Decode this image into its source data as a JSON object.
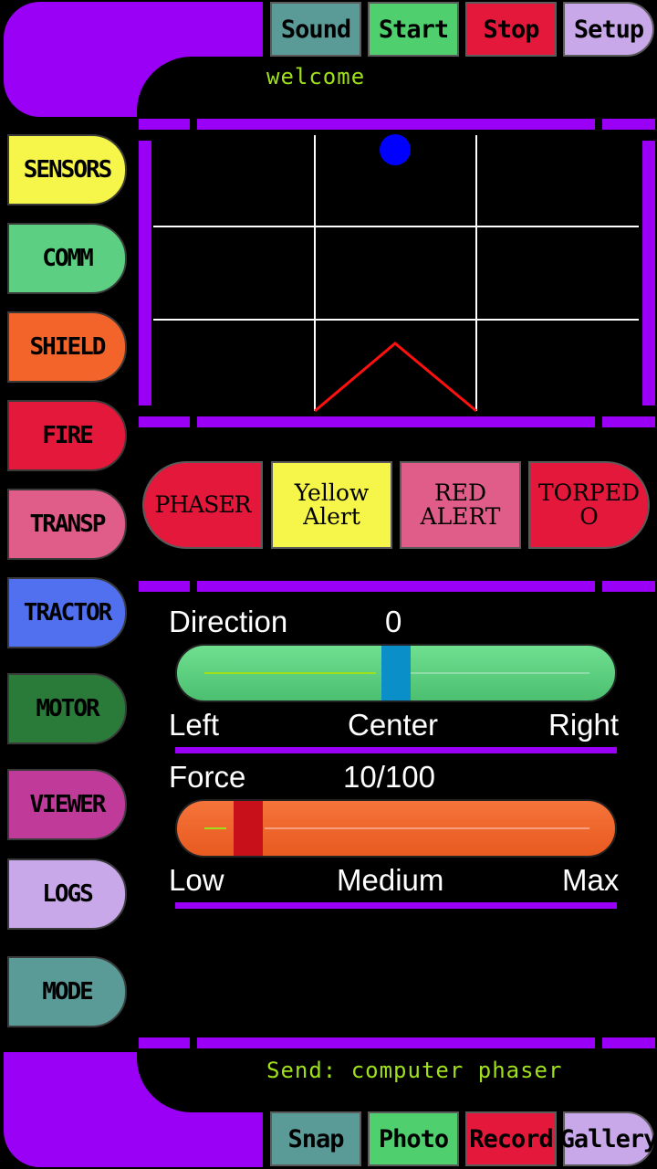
{
  "header": {
    "welcome": "welcome"
  },
  "top_buttons": [
    {
      "label": "Sound",
      "color": "#5a9a97"
    },
    {
      "label": "Start",
      "color": "#4fcf6e"
    },
    {
      "label": "Stop",
      "color": "#e3183a"
    },
    {
      "label": "Setup",
      "color": "#c8a8e8"
    }
  ],
  "sidebar": {
    "items": [
      {
        "label": "SENSORS",
        "color": "#f5f54a"
      },
      {
        "label": "COMM",
        "color": "#5dcf82"
      },
      {
        "label": "SHIELD",
        "color": "#f2642a"
      },
      {
        "label": "FIRE",
        "color": "#e3183a"
      },
      {
        "label": "TRANSP",
        "color": "#e05d8a"
      },
      {
        "label": "TRACTOR",
        "color": "#5070f0"
      },
      {
        "label": "MOTOR",
        "color": "#2a7a3a"
      },
      {
        "label": "VIEWER",
        "color": "#c03a9a"
      },
      {
        "label": "LOGS",
        "color": "#c8a8e8"
      },
      {
        "label": "MODE",
        "color": "#5a9a97"
      }
    ]
  },
  "alerts": [
    {
      "line1": "PHASER",
      "line2": "",
      "color": "#e3183a"
    },
    {
      "line1": "Yellow",
      "line2": "Alert",
      "color": "#f5f54a"
    },
    {
      "line1": "RED",
      "line2": "ALERT",
      "color": "#e05d8a"
    },
    {
      "line1": "TORPED",
      "line2": "O",
      "color": "#e3183a"
    }
  ],
  "direction": {
    "label": "Direction",
    "value": "0",
    "position": 0.5,
    "left": "Left",
    "center": "Center",
    "right": "Right",
    "track_color": "#5dcf82",
    "thumb_color": "#0a8fc8"
  },
  "force": {
    "label": "Force",
    "value": "10/100",
    "position": 0.1,
    "low": "Low",
    "medium": "Medium",
    "max": "Max",
    "track_color": "#f2642a",
    "thumb_color": "#c8101a"
  },
  "status": {
    "text": "Send: computer phaser"
  },
  "bottom_buttons": [
    {
      "label": "Snap",
      "color": "#5a9a97"
    },
    {
      "label": "Photo",
      "color": "#4fcf6e"
    },
    {
      "label": "Record",
      "color": "#e3183a"
    },
    {
      "label": "Gallery",
      "color": "#c8a8e8"
    }
  ],
  "colors": {
    "frame": "#9a00f5",
    "accent_text": "#9ee01a",
    "radar_ball": "#0000ff",
    "radar_line": "#ff1010"
  }
}
